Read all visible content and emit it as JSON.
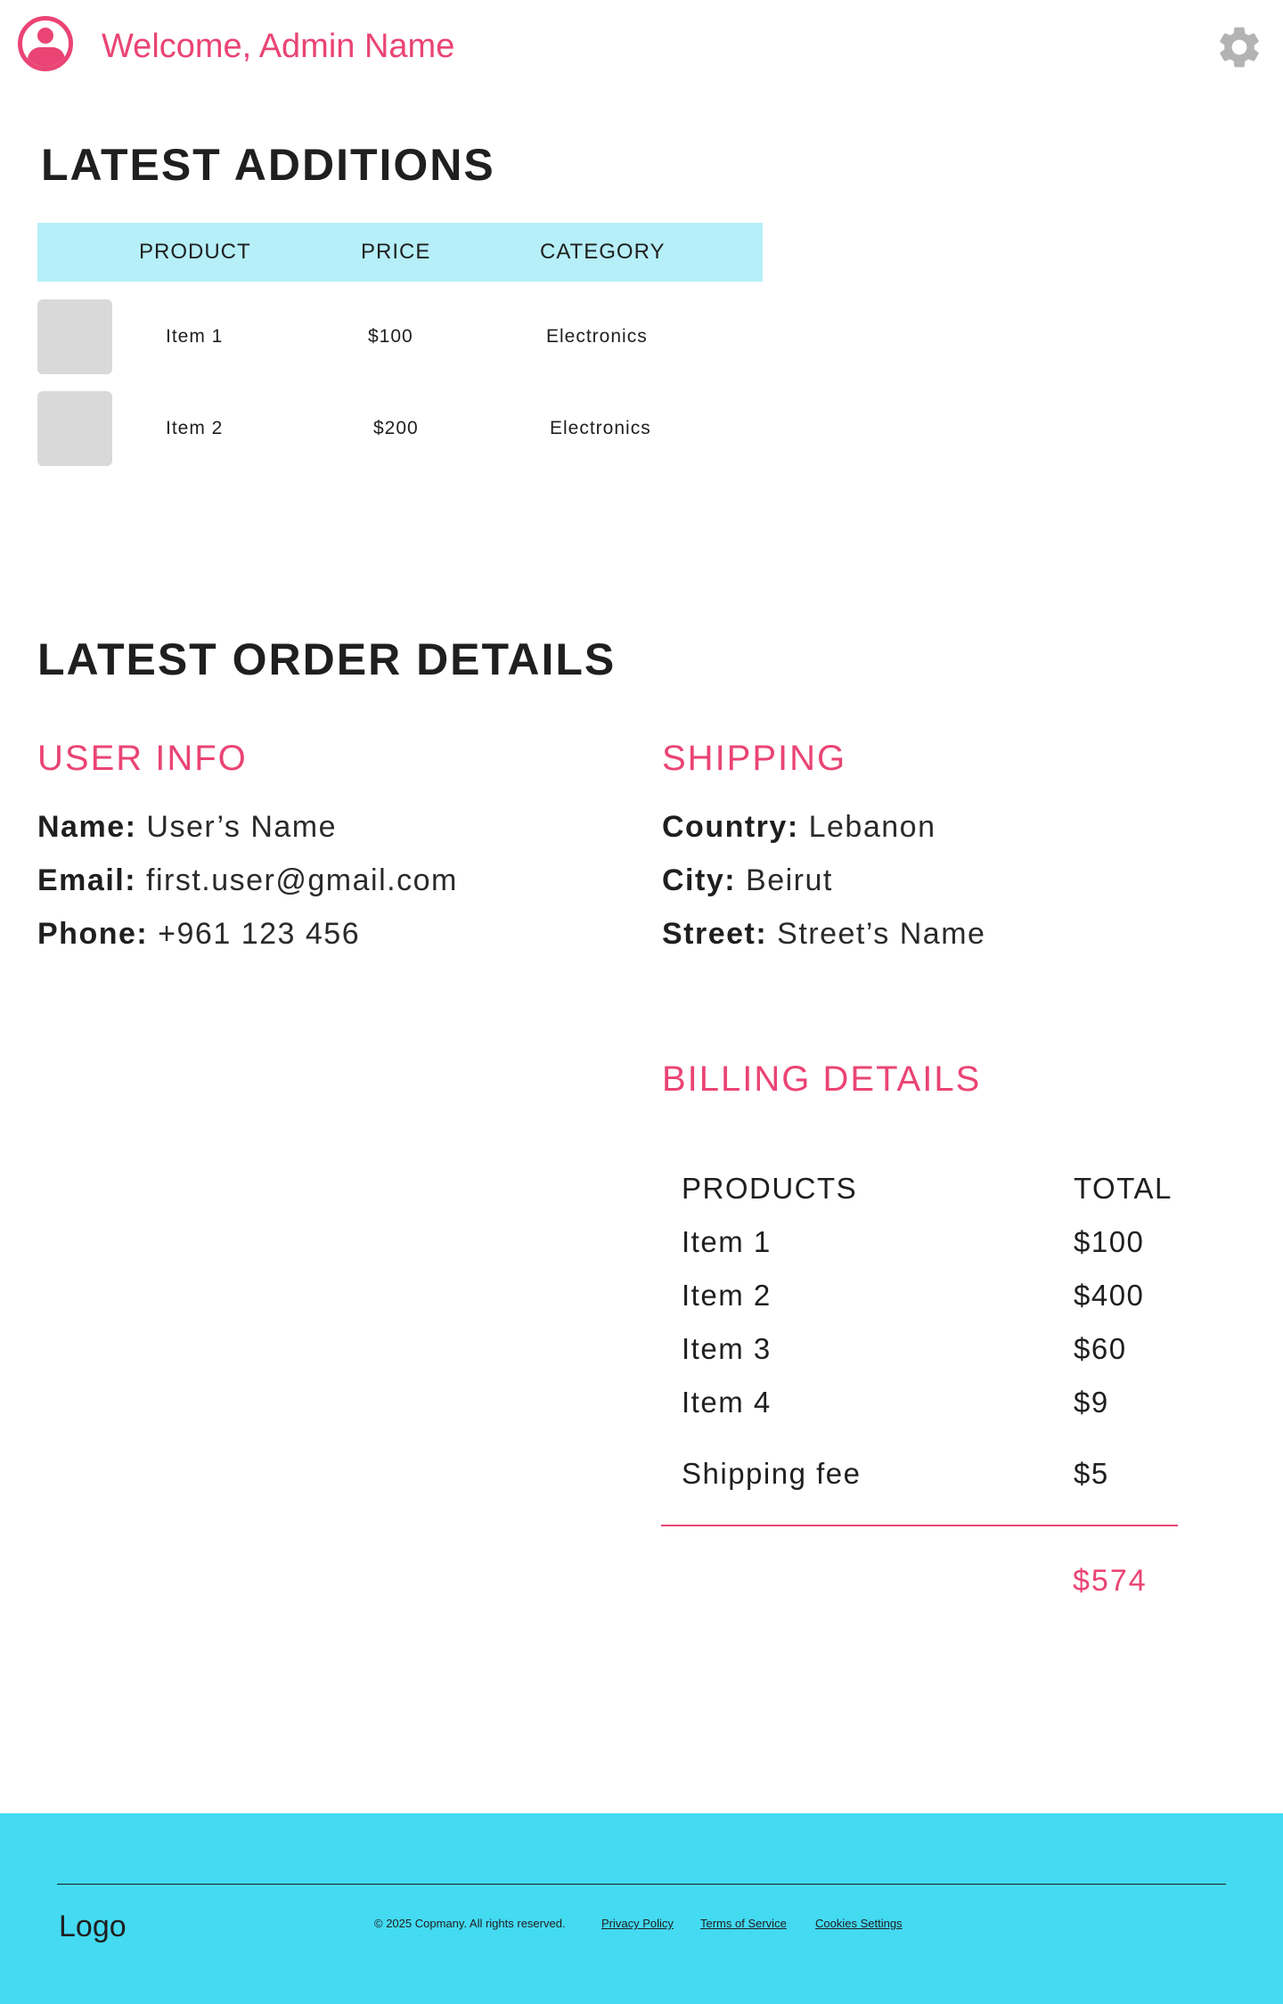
{
  "header": {
    "welcome": "Welcome, Admin Name",
    "avatar_icon": "user-avatar-icon",
    "settings_icon": "gear-icon"
  },
  "additions": {
    "title": "LATEST ADDITIONS",
    "columns": [
      "PRODUCT",
      "PRICE",
      "CATEGORY"
    ],
    "rows": [
      {
        "product": "Item 1",
        "price": "$100",
        "category": "Electronics"
      },
      {
        "product": "Item 2",
        "price": "$200",
        "category": "Electronics"
      }
    ]
  },
  "order": {
    "title": "LATEST ORDER DETAILS",
    "user_info": {
      "heading": "USER INFO",
      "name_label": "Name:",
      "name": "User’s Name",
      "email_label": "Email:",
      "email": "first.user@gmail.com",
      "phone_label": "Phone:",
      "phone": "+961 123 456"
    },
    "shipping": {
      "heading": "SHIPPING",
      "country_label": "Country:",
      "country": "Lebanon",
      "city_label": "City:",
      "city": "Beirut",
      "street_label": "Street:",
      "street": "Street’s Name"
    },
    "billing": {
      "heading": "BILLING DETAILS",
      "col_products": "PRODUCTS",
      "col_total": "TOTAL",
      "items": [
        {
          "name": "Item 1",
          "total": "$100"
        },
        {
          "name": "Item 2",
          "total": "$400"
        },
        {
          "name": "Item 3",
          "total": "$60"
        },
        {
          "name": "Item 4",
          "total": "$9"
        }
      ],
      "shipping_fee_label": "Shipping fee",
      "shipping_fee": "$5",
      "grand_total": "$574"
    }
  },
  "footer": {
    "logo": "Logo",
    "copyright": "© 2025 Copmany. All rights reserved.",
    "links": [
      "Privacy Policy",
      "Terms of Service",
      "Cookies Settings"
    ]
  },
  "colors": {
    "accent": "#ea4474",
    "table_header": "#b6eff8",
    "footer_bg": "#43daf2",
    "thumbnail": "#d9d9d9",
    "gear": "#b3b3b3"
  }
}
